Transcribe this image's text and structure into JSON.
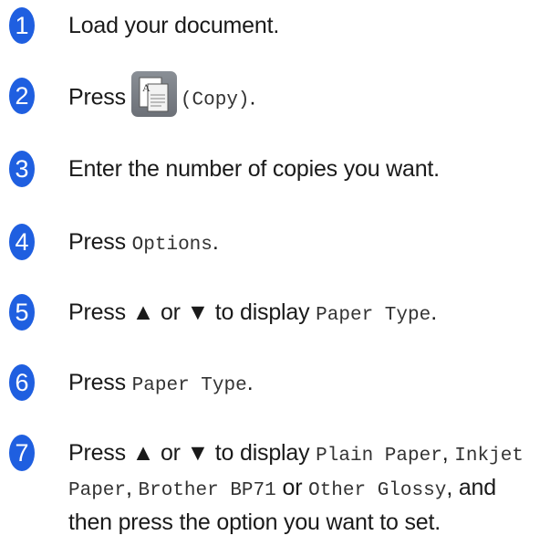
{
  "steps": [
    {
      "number": "1",
      "text": "Load your document."
    },
    {
      "number": "2",
      "press": "Press",
      "icon": "copy-icon",
      "icon_letter": "A",
      "code": "(Copy)",
      "end": "."
    },
    {
      "number": "3",
      "text": "Enter the number of copies you want."
    },
    {
      "number": "4",
      "press": "Press",
      "code": "Options",
      "end": "."
    },
    {
      "number": "5",
      "press": "Press ▲ or ▼ to display",
      "code": "Paper Type",
      "end": "."
    },
    {
      "number": "6",
      "press": "Press",
      "code": "Paper Type",
      "end": "."
    },
    {
      "number": "7",
      "press": "Press ▲ or ▼ to display",
      "code1": "Plain Paper",
      "comma1": ",",
      "code2": "Inkjet Paper",
      "comma2": ",",
      "code3": "Brother BP71",
      "or": "or",
      "code4": "Other Glossy",
      "rest": ", and then press the option you want to set."
    }
  ],
  "colors": {
    "step_number_bg": "#1f5fe0",
    "icon_bg": "#7a7e85"
  }
}
